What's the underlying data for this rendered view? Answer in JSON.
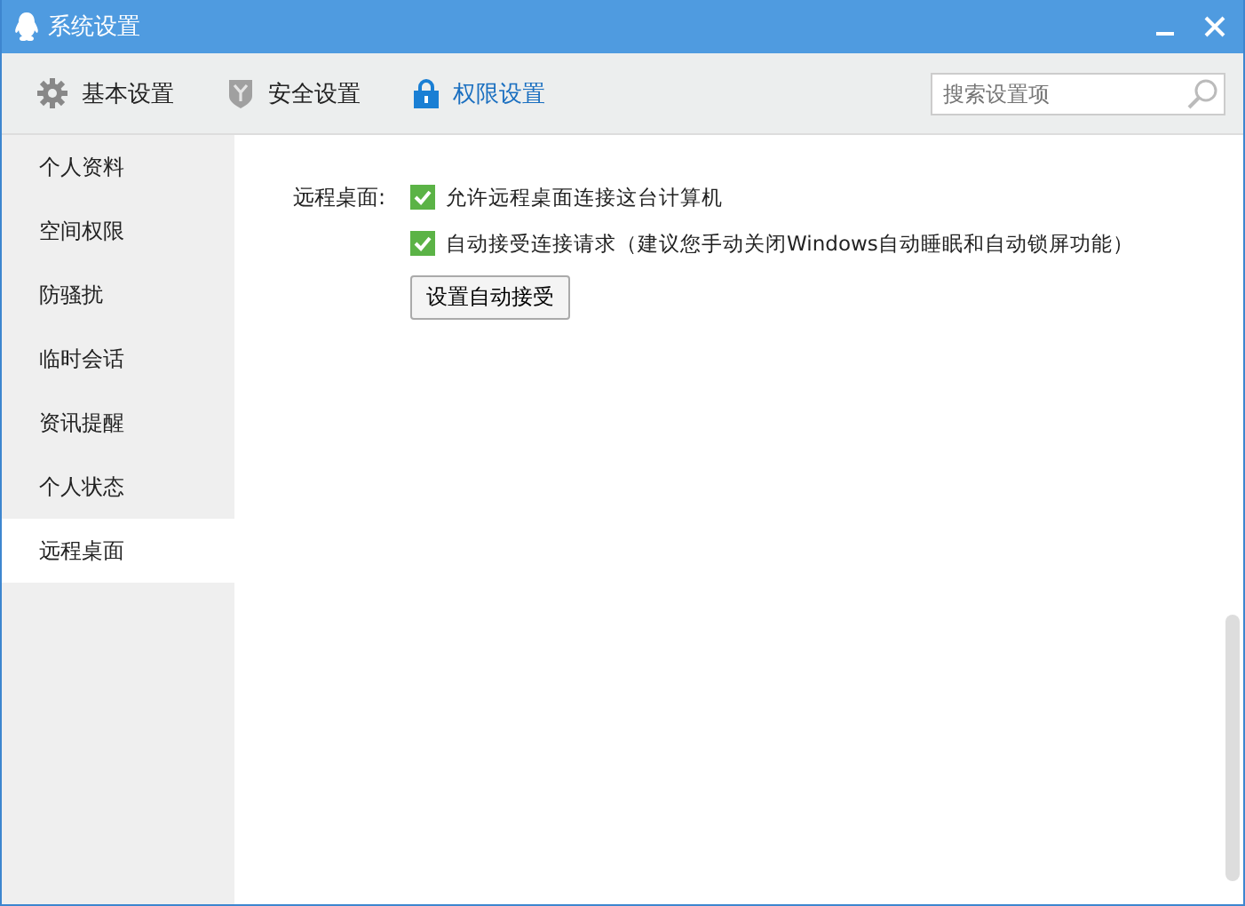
{
  "window": {
    "title": "系统设置"
  },
  "tabs": [
    {
      "label": "基本设置",
      "kind": "gear",
      "selected": false
    },
    {
      "label": "安全设置",
      "kind": "shield",
      "selected": false
    },
    {
      "label": "权限设置",
      "kind": "lock",
      "selected": true
    }
  ],
  "search": {
    "placeholder": "搜索设置项"
  },
  "sidebar": {
    "items": [
      {
        "label": "个人资料",
        "selected": false
      },
      {
        "label": "空间权限",
        "selected": false
      },
      {
        "label": "防骚扰",
        "selected": false
      },
      {
        "label": "临时会话",
        "selected": false
      },
      {
        "label": "资讯提醒",
        "selected": false
      },
      {
        "label": "个人状态",
        "selected": false
      },
      {
        "label": "远程桌面",
        "selected": true
      }
    ]
  },
  "section": {
    "label": "远程桌面:",
    "options": [
      {
        "label": "允许远程桌面连接这台计算机",
        "checked": true
      },
      {
        "label": "自动接受连接请求（建议您手动关闭Windows自动睡眠和自动锁屏功能）",
        "checked": true
      }
    ],
    "button": "设置自动接受"
  }
}
